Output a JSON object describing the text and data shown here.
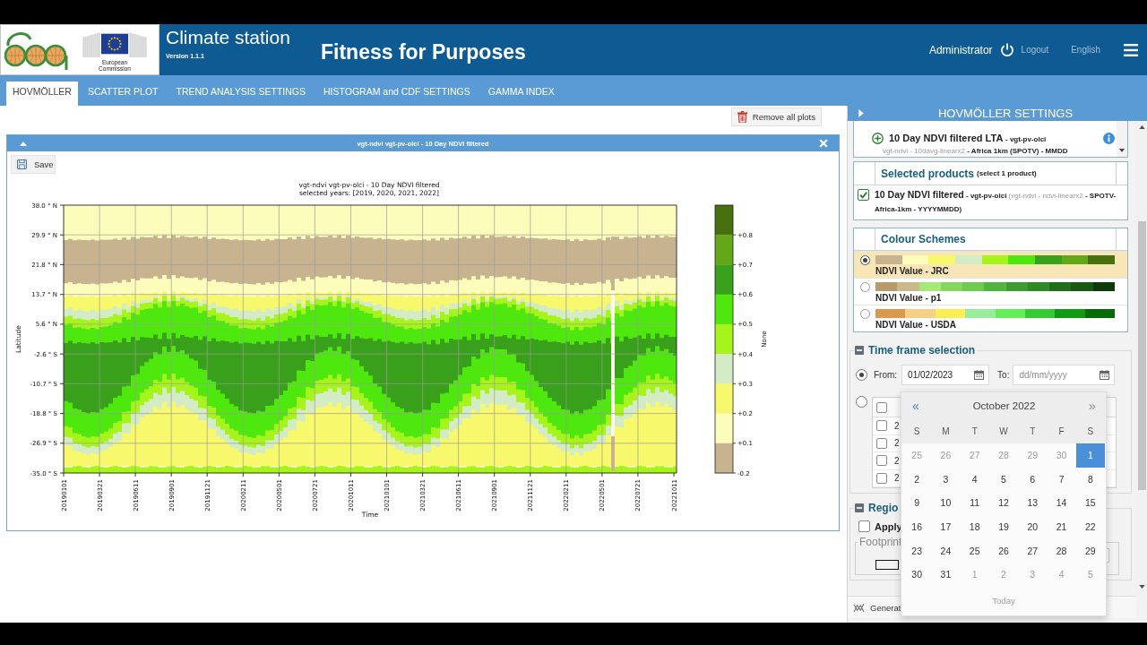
{
  "header": {
    "logo_caption": [
      "European",
      "Commission"
    ],
    "app_title": "Climate station",
    "version": "Version 1.1.1",
    "page_title": "Fitness for Purposes",
    "user": "Administrator",
    "logout": "Logout",
    "language": "English"
  },
  "tabs": [
    {
      "label": "HOVMÖLLER",
      "selected": true
    },
    {
      "label": "SCATTER PLOT",
      "selected": false
    },
    {
      "label": "TREND ANALYSIS SETTINGS",
      "selected": false
    },
    {
      "label": "HISTOGRAM and CDF SETTINGS",
      "selected": false
    },
    {
      "label": "GAMMA INDEX",
      "selected": false
    }
  ],
  "toolbar": {
    "remove_all": "Remove all plots"
  },
  "plot_panel": {
    "title": "vgt-ndvi vgt-pv-olci - 10 Day NDVI filtered",
    "save": "Save",
    "figure": {
      "title_lines": [
        "vgt-ndvi vgt-pv-olci - 10 Day NDVI filtered",
        "selected years: [2019, 2020, 2021, 2022]"
      ],
      "ylabel": "Latitude",
      "xlabel": "Time",
      "yticks": [
        "38.0 ° N",
        "29.9 ° N",
        "21.8 ° N",
        "13.7 ° N",
        "5.6 ° N",
        "-2.6 ° S",
        "-10.7 ° S",
        "-18.8 ° S",
        "-26.9 ° S",
        "-35.0 ° S"
      ],
      "xticks": [
        "20190101",
        "20190321",
        "20190611",
        "20190901",
        "20191121",
        "20200211",
        "20200501",
        "20200721",
        "20201011",
        "20210101",
        "20210321",
        "20210611",
        "20210901",
        "20211121",
        "20220211",
        "20220501",
        "20220721",
        "20221011"
      ],
      "colorbar": {
        "label": "None",
        "segments": [
          {
            "color": "#47700f",
            "tick": "+0.8"
          },
          {
            "color": "#62a818",
            "tick": "+0.7"
          },
          {
            "color": "#38a01a",
            "tick": "+0.6"
          },
          {
            "color": "#4fe80e",
            "tick": "+0.5"
          },
          {
            "color": "#a6f41c",
            "tick": "+0.4"
          },
          {
            "color": "#d4ecc5",
            "tick": "+0.3"
          },
          {
            "color": "#f8f86c",
            "tick": "+0.2"
          },
          {
            "color": "#fdfdbb",
            "tick": "+0.1"
          },
          {
            "color": "#c8b391",
            "tick": "-0.2"
          }
        ]
      }
    }
  },
  "settings": {
    "title": "HOVMÖLLER SETTINGS",
    "product_list": [
      {
        "name": "10 Day NDVI filtered LTA",
        "version": "- vgt-pv-olci",
        "detail_muted": "vgt-ndvi - 10davg-linearx2",
        "detail": "- Africa 1km (SPOTV) - MMDD"
      }
    ],
    "selected_products": {
      "title": "Selected products",
      "hint": "(select 1 product)",
      "items": [
        {
          "checked": true,
          "name": "10 Day NDVI filtered",
          "version": "- vgt-pv-olci",
          "detail_muted": "(vgt-ndvi - ndvi-linearx2",
          "detail": "- SPOTV-Africa-1km - YYYYMMDD)"
        }
      ]
    },
    "colour_schemes": {
      "title": "Colour Schemes",
      "items": [
        {
          "label": "NDVI Value - JRC",
          "selected": true,
          "colors": [
            {
              "color": "#c8b391"
            },
            {
              "color": "#fdfdbb"
            },
            {
              "color": "#f8f86c"
            },
            {
              "color": "#d4ecc5"
            },
            {
              "color": "#a6f41c"
            },
            {
              "color": "#4fe80e"
            },
            {
              "color": "#38a01a"
            },
            {
              "color": "#62a818"
            },
            {
              "color": "#47700f"
            }
          ]
        },
        {
          "label": "NDVI Value - p1",
          "selected": false,
          "colors": [
            {
              "color": "#b89a66"
            },
            {
              "color": "#c8b88a"
            },
            {
              "color": "#a4e876"
            },
            {
              "color": "#86d65c"
            },
            {
              "color": "#6ccb50"
            },
            {
              "color": "#50b43e"
            },
            {
              "color": "#3c9c32"
            },
            {
              "color": "#2d8a26"
            },
            {
              "color": "#1f6f1a"
            },
            {
              "color": "#185a12"
            },
            {
              "color": "#0f3a0a"
            }
          ]
        },
        {
          "label": "NDVI Value - USDA",
          "selected": false,
          "colors": [
            {
              "color": "#d99a4e"
            },
            {
              "color": "#f5cf86"
            },
            {
              "color": "#fbee55"
            },
            {
              "color": "#98ee98"
            },
            {
              "color": "#64ee58"
            },
            {
              "color": "#33cc33"
            },
            {
              "color": "#0f9a12"
            },
            {
              "color": "#066a06"
            }
          ]
        }
      ]
    },
    "time_frame": {
      "title": "Time frame selection",
      "expanded": true,
      "range": {
        "selected": true,
        "from_label": "From:",
        "from_value": "01/02/2023",
        "to_label": "To:",
        "to_placeholder": "dd/mm/yyyy"
      },
      "years": {
        "selected": false,
        "select_all_checked": false,
        "rows": [
          {
            "label": "2",
            "checked": false
          },
          {
            "label": "2",
            "checked": false
          },
          {
            "label": "2",
            "checked": false
          },
          {
            "label": "2",
            "checked": false
          }
        ]
      }
    },
    "calendar": {
      "prev": "«",
      "month": "October 2022",
      "next": "»",
      "weekdays": [
        "S",
        "M",
        "T",
        "W",
        "T",
        "F",
        "S"
      ],
      "weeks": [
        {
          "days": [
            {
              "day": "25",
              "other_month": true,
              "selected": false
            },
            {
              "day": "26",
              "other_month": true,
              "selected": false
            },
            {
              "day": "27",
              "other_month": true,
              "selected": false
            },
            {
              "day": "28",
              "other_month": true,
              "selected": false
            },
            {
              "day": "29",
              "other_month": true,
              "selected": false
            },
            {
              "day": "30",
              "other_month": true,
              "selected": false
            },
            {
              "day": "1",
              "other_month": false,
              "selected": true
            }
          ]
        },
        {
          "days": [
            {
              "day": "2",
              "other_month": false,
              "selected": false
            },
            {
              "day": "3",
              "other_month": false,
              "selected": false
            },
            {
              "day": "4",
              "other_month": false,
              "selected": false
            },
            {
              "day": "5",
              "other_month": false,
              "selected": false
            },
            {
              "day": "6",
              "other_month": false,
              "selected": false
            },
            {
              "day": "7",
              "other_month": false,
              "selected": false
            },
            {
              "day": "8",
              "other_month": false,
              "selected": false
            }
          ]
        },
        {
          "days": [
            {
              "day": "9",
              "other_month": false,
              "selected": false
            },
            {
              "day": "10",
              "other_month": false,
              "selected": false
            },
            {
              "day": "11",
              "other_month": false,
              "selected": false
            },
            {
              "day": "12",
              "other_month": false,
              "selected": false
            },
            {
              "day": "13",
              "other_month": false,
              "selected": false
            },
            {
              "day": "14",
              "other_month": false,
              "selected": false
            },
            {
              "day": "15",
              "other_month": false,
              "selected": false
            }
          ]
        },
        {
          "days": [
            {
              "day": "16",
              "other_month": false,
              "selected": false
            },
            {
              "day": "17",
              "other_month": false,
              "selected": false
            },
            {
              "day": "18",
              "other_month": false,
              "selected": false
            },
            {
              "day": "19",
              "other_month": false,
              "selected": false
            },
            {
              "day": "20",
              "other_month": false,
              "selected": false
            },
            {
              "day": "21",
              "other_month": false,
              "selected": false
            },
            {
              "day": "22",
              "other_month": false,
              "selected": false
            }
          ]
        },
        {
          "days": [
            {
              "day": "23",
              "other_month": false,
              "selected": false
            },
            {
              "day": "24",
              "other_month": false,
              "selected": false
            },
            {
              "day": "25",
              "other_month": false,
              "selected": false
            },
            {
              "day": "26",
              "other_month": false,
              "selected": false
            },
            {
              "day": "27",
              "other_month": false,
              "selected": false
            },
            {
              "day": "28",
              "other_month": false,
              "selected": false
            },
            {
              "day": "29",
              "other_month": false,
              "selected": false
            }
          ]
        },
        {
          "days": [
            {
              "day": "30",
              "other_month": false,
              "selected": false
            },
            {
              "day": "31",
              "other_month": false,
              "selected": false
            },
            {
              "day": "1",
              "other_month": true,
              "selected": false
            },
            {
              "day": "2",
              "other_month": true,
              "selected": false
            },
            {
              "day": "3",
              "other_month": true,
              "selected": false
            },
            {
              "day": "4",
              "other_month": true,
              "selected": false
            },
            {
              "day": "5",
              "other_month": true,
              "selected": false
            }
          ]
        }
      ],
      "today": {
        "label": "Today",
        "disabled": true
      }
    },
    "region": {
      "title": "Regio",
      "expanded": true,
      "apply": {
        "label": "Apply",
        "checked": false
      },
      "footprint": "Footprint"
    },
    "generate": "Generat"
  }
}
